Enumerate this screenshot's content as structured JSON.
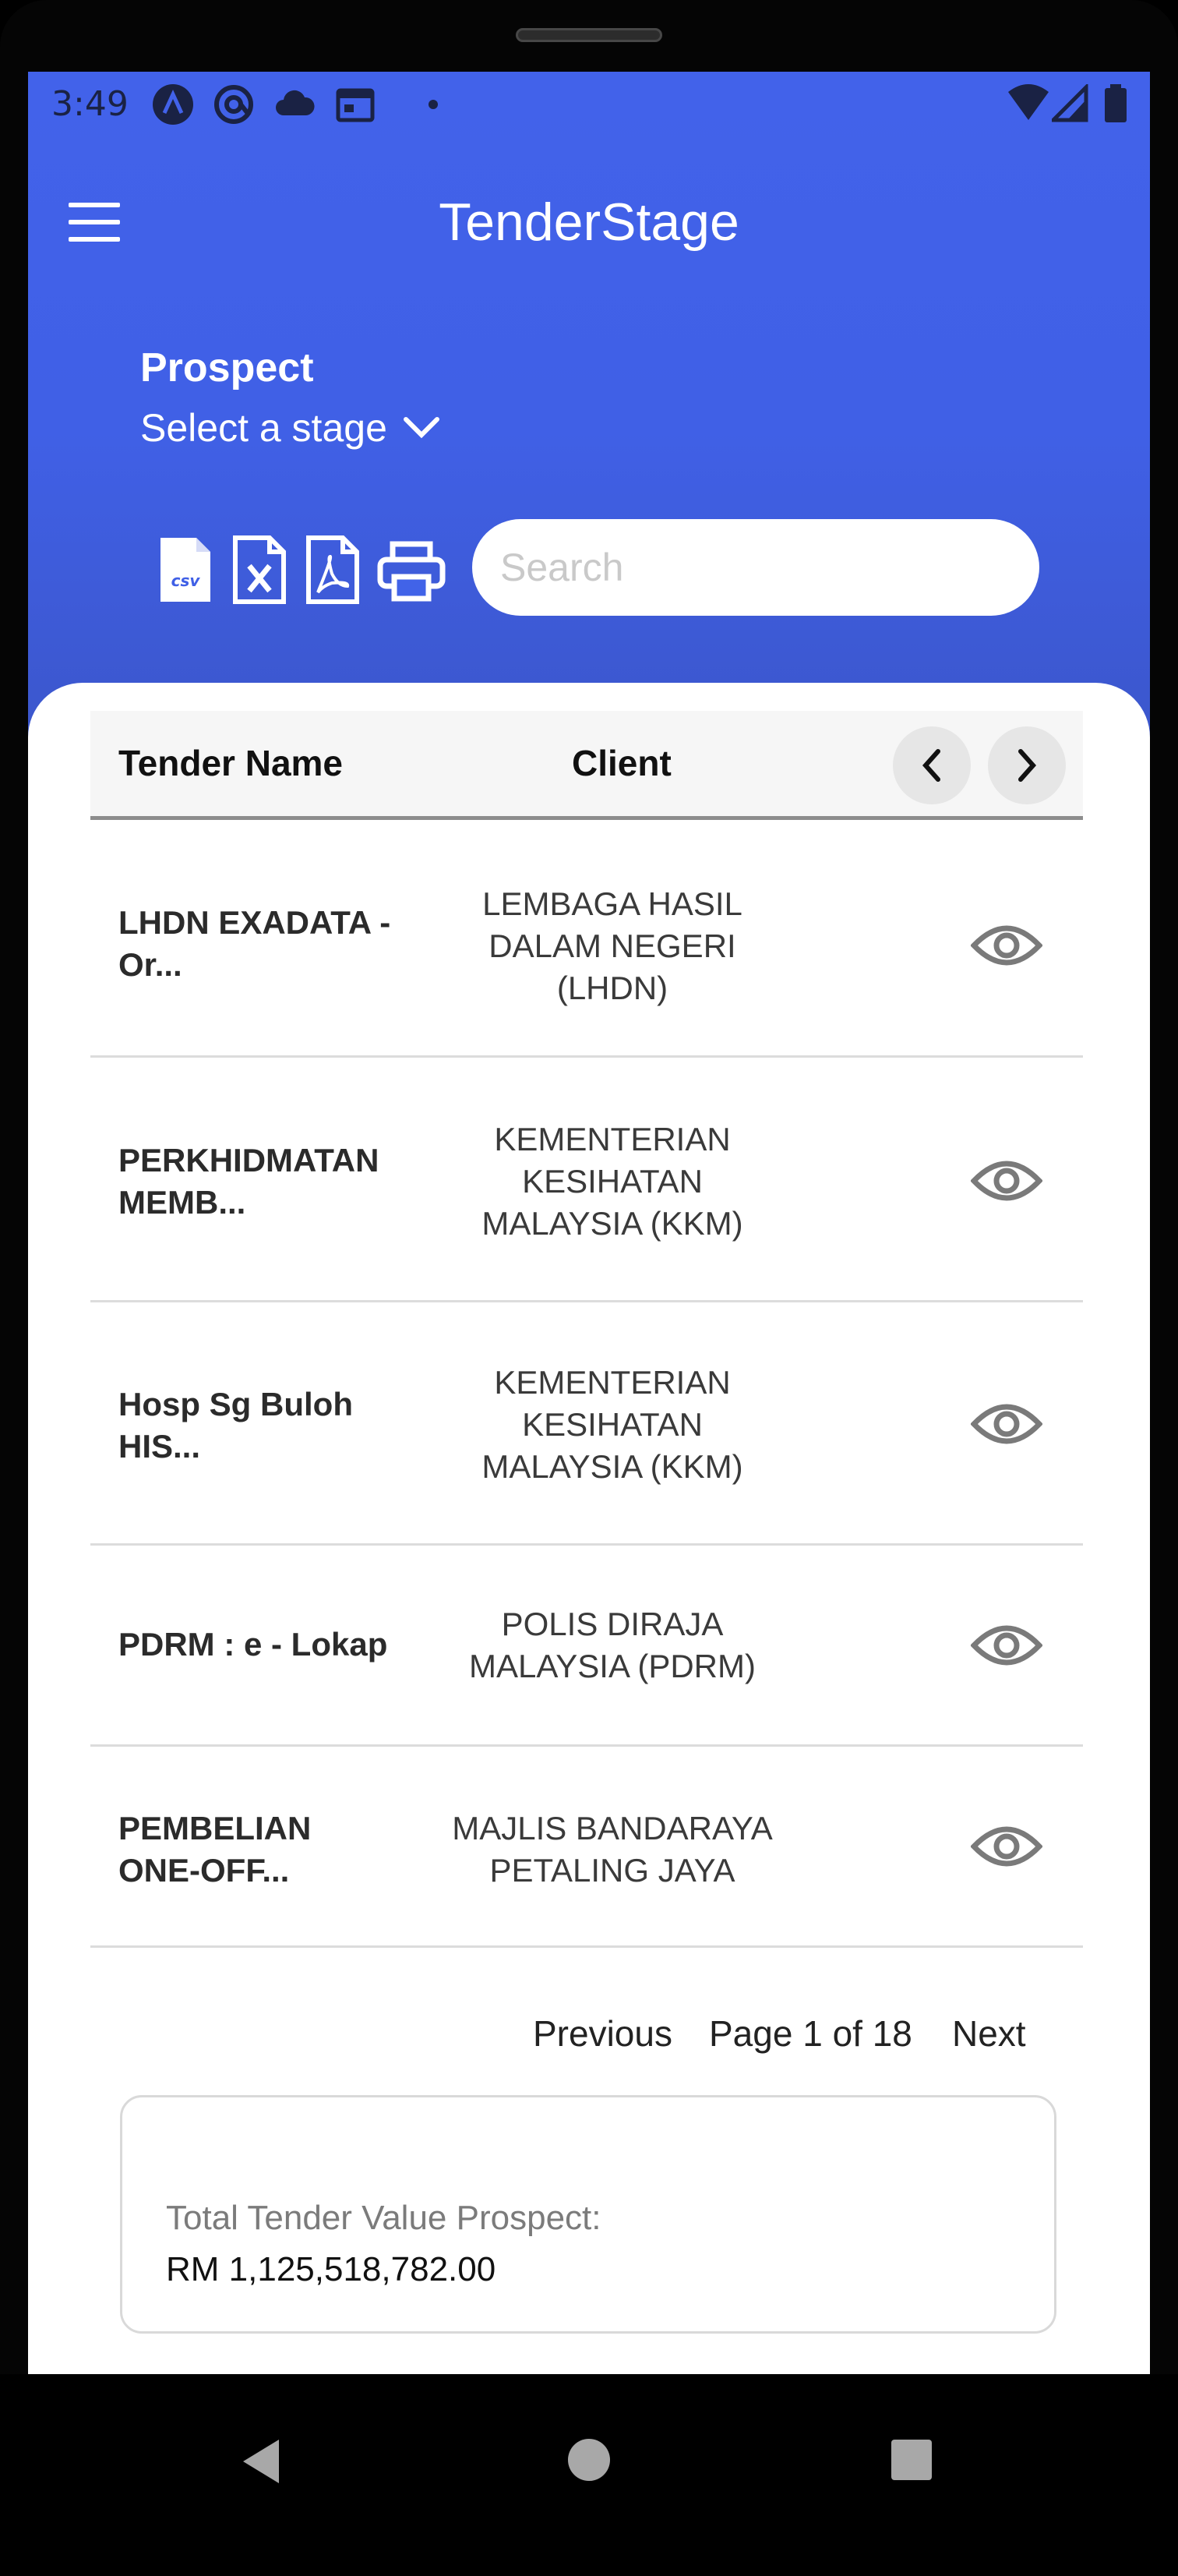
{
  "status_bar": {
    "time": "3:49",
    "left_icons": [
      "a-icon",
      "at-sign-icon",
      "cloud-icon",
      "calendar-icon",
      "dot-icon"
    ],
    "right_icons": [
      "wifi-icon",
      "signal-icon",
      "battery-icon"
    ]
  },
  "app": {
    "title": "TenderStage"
  },
  "stage": {
    "label": "Prospect",
    "select_text": "Select a stage"
  },
  "toolbar": {
    "export_icons": [
      "csv-file-icon",
      "excel-file-icon",
      "pdf-file-icon",
      "printer-icon"
    ],
    "search_placeholder": "Search",
    "search_value": ""
  },
  "table": {
    "columns": [
      "Tender Name",
      "Client"
    ],
    "rows": [
      {
        "name": [
          "LHDN EXADATA -",
          "Or..."
        ],
        "client": [
          "LEMBAGA HASIL",
          "DALAM NEGERI",
          "(LHDN)"
        ]
      },
      {
        "name": [
          "PERKHIDMATAN",
          "MEMB..."
        ],
        "client": [
          "KEMENTERIAN",
          "KESIHATAN",
          "MALAYSIA (KKM)"
        ]
      },
      {
        "name": [
          "Hosp Sg Buloh",
          "HIS..."
        ],
        "client": [
          "KEMENTERIAN",
          "KESIHATAN",
          "MALAYSIA (KKM)"
        ]
      },
      {
        "name": [
          "PDRM : e - Lokap"
        ],
        "client": [
          "POLIS DIRAJA",
          "MALAYSIA (PDRM)"
        ]
      },
      {
        "name": [
          "PEMBELIAN",
          "ONE-OFF..."
        ],
        "client": [
          "MAJLIS BANDARAYA",
          "PETALING JAYA"
        ]
      }
    ]
  },
  "pagination": {
    "previous": "Previous",
    "info": "Page 1 of 18",
    "next": "Next"
  },
  "total": {
    "label": "Total Tender Value Prospect:",
    "value": "RM 1,125,518,782.00"
  },
  "colors": {
    "header_top": "#4262ea",
    "header_bottom": "#3b55c8",
    "icon_gray": "#7a7a7a"
  }
}
